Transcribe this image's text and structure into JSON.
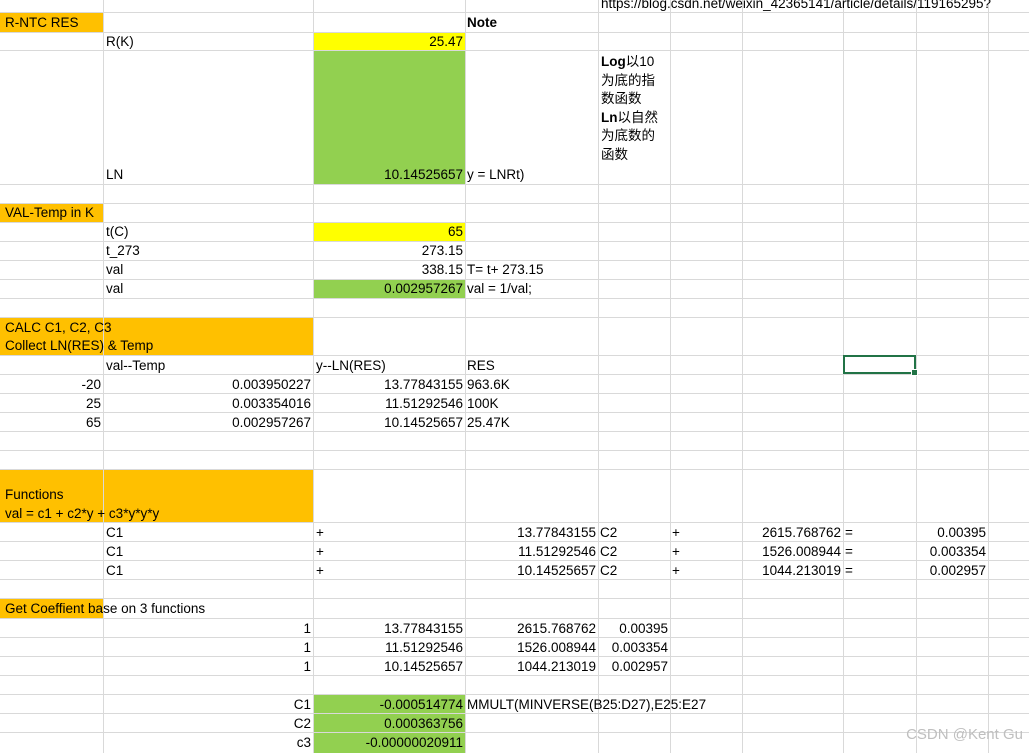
{
  "url": "https://blog.csdn.net/weixin_42365141/article/details/119165295?",
  "watermark": "CSDN @Kent Gu",
  "colors": {
    "orange": "#FFC000",
    "yellow": "#FFFF00",
    "green": "#92D050",
    "grid": "#D9D9D9",
    "select": "#217346"
  },
  "note": {
    "header": "Note",
    "lines": [
      {
        "bold": "Log",
        "text": "以10"
      },
      {
        "bold": "",
        "text": "为底的指"
      },
      {
        "bold": "",
        "text": "数函数"
      },
      {
        "bold": "Ln",
        "text": "以自然"
      },
      {
        "bold": "",
        "text": "为底数的"
      },
      {
        "bold": "",
        "text": "函数"
      }
    ]
  },
  "cells": [
    {
      "id": "a1",
      "text": "R-NTC RES",
      "align": "l"
    },
    {
      "id": "b2",
      "text": "R(K)",
      "align": "l"
    },
    {
      "id": "c2",
      "text": "25.47",
      "align": "r"
    },
    {
      "id": "b3",
      "text": "LN",
      "align": "l"
    },
    {
      "id": "c3",
      "text": "10.14525657",
      "align": "r"
    },
    {
      "id": "d3",
      "text": "y = LNRt)",
      "align": "l"
    },
    {
      "id": "a5",
      "text": "VAL-Temp in K",
      "align": "l"
    },
    {
      "id": "b6",
      "text": "t(C)",
      "align": "l"
    },
    {
      "id": "c6",
      "text": "65",
      "align": "r"
    },
    {
      "id": "b7",
      "text": "t_273",
      "align": "l"
    },
    {
      "id": "c7",
      "text": "273.15",
      "align": "r"
    },
    {
      "id": "b8",
      "text": "val",
      "align": "l"
    },
    {
      "id": "c8",
      "text": "338.15",
      "align": "r"
    },
    {
      "id": "d8",
      "text": "T= t+ 273.15",
      "align": "l"
    },
    {
      "id": "b9",
      "text": "val",
      "align": "l"
    },
    {
      "id": "c9",
      "text": "0.002957267",
      "align": "r"
    },
    {
      "id": "d9",
      "text": "val = 1/val;",
      "align": "l"
    },
    {
      "id": "a11a",
      "text": "CALC C1, C2, C3",
      "align": "l"
    },
    {
      "id": "a11b",
      "text": "Collect  LN(RES) & Temp",
      "align": "l"
    },
    {
      "id": "b12",
      "text": "val--Temp",
      "align": "l"
    },
    {
      "id": "c12",
      "text": "y--LN(RES)",
      "align": "l"
    },
    {
      "id": "d12",
      "text": "RES",
      "align": "l"
    },
    {
      "id": "a13",
      "text": "-20",
      "align": "r"
    },
    {
      "id": "b13",
      "text": "0.003950227",
      "align": "r"
    },
    {
      "id": "c13",
      "text": "13.77843155",
      "align": "r"
    },
    {
      "id": "d13",
      "text": "963.6K",
      "align": "l"
    },
    {
      "id": "a14",
      "text": "25",
      "align": "r"
    },
    {
      "id": "b14",
      "text": "0.003354016",
      "align": "r"
    },
    {
      "id": "c14",
      "text": "11.51292546",
      "align": "r"
    },
    {
      "id": "d14",
      "text": "100K",
      "align": "l"
    },
    {
      "id": "a15",
      "text": "65",
      "align": "r"
    },
    {
      "id": "b15",
      "text": "0.002957267",
      "align": "r"
    },
    {
      "id": "c15",
      "text": "10.14525657",
      "align": "r"
    },
    {
      "id": "d15",
      "text": "25.47K",
      "align": "l"
    },
    {
      "id": "a18a",
      "text": "Functions",
      "align": "l"
    },
    {
      "id": "a18b",
      "text": "val = c1 + c2*y + c3*y*y*y",
      "align": "l"
    },
    {
      "id": "b19",
      "text": "C1",
      "align": "l"
    },
    {
      "id": "c19",
      "text": "+",
      "align": "l"
    },
    {
      "id": "d19",
      "text": "13.77843155",
      "align": "r"
    },
    {
      "id": "e19",
      "text": "C2",
      "align": "l"
    },
    {
      "id": "f19",
      "text": "+",
      "align": "l"
    },
    {
      "id": "g19",
      "text": "2615.768762",
      "align": "r"
    },
    {
      "id": "h19",
      "text": "=",
      "align": "l"
    },
    {
      "id": "i19",
      "text": "0.00395",
      "align": "r"
    },
    {
      "id": "b20",
      "text": "C1",
      "align": "l"
    },
    {
      "id": "c20",
      "text": "+",
      "align": "l"
    },
    {
      "id": "d20",
      "text": "11.51292546",
      "align": "r"
    },
    {
      "id": "e20",
      "text": "C2",
      "align": "l"
    },
    {
      "id": "f20",
      "text": "+",
      "align": "l"
    },
    {
      "id": "g20",
      "text": "1526.008944",
      "align": "r"
    },
    {
      "id": "h20",
      "text": "=",
      "align": "l"
    },
    {
      "id": "i20",
      "text": "0.003354",
      "align": "r"
    },
    {
      "id": "b21",
      "text": "C1",
      "align": "l"
    },
    {
      "id": "c21",
      "text": "+",
      "align": "l"
    },
    {
      "id": "d21",
      "text": "10.14525657",
      "align": "r"
    },
    {
      "id": "e21",
      "text": "C2",
      "align": "l"
    },
    {
      "id": "f21",
      "text": "+",
      "align": "l"
    },
    {
      "id": "g21",
      "text": "1044.213019",
      "align": "r"
    },
    {
      "id": "h21",
      "text": "=",
      "align": "l"
    },
    {
      "id": "i21",
      "text": "0.002957",
      "align": "r"
    },
    {
      "id": "a23",
      "text": "Get Coeffient base on 3 functions",
      "align": "l"
    },
    {
      "id": "b24",
      "text": "1",
      "align": "r"
    },
    {
      "id": "c24",
      "text": "13.77843155",
      "align": "r"
    },
    {
      "id": "d24",
      "text": "2615.768762",
      "align": "r"
    },
    {
      "id": "e24",
      "text": "0.00395",
      "align": "r"
    },
    {
      "id": "b25",
      "text": "1",
      "align": "r"
    },
    {
      "id": "c25",
      "text": "11.51292546",
      "align": "r"
    },
    {
      "id": "d25",
      "text": "1526.008944",
      "align": "r"
    },
    {
      "id": "e25",
      "text": "0.003354",
      "align": "r"
    },
    {
      "id": "b26",
      "text": "1",
      "align": "r"
    },
    {
      "id": "c26",
      "text": "10.14525657",
      "align": "r"
    },
    {
      "id": "d26",
      "text": "1044.213019",
      "align": "r"
    },
    {
      "id": "e26",
      "text": "0.002957",
      "align": "r"
    },
    {
      "id": "b28",
      "text": "C1",
      "align": "r"
    },
    {
      "id": "c28",
      "text": "-0.000514774",
      "align": "r"
    },
    {
      "id": "d28",
      "text": "MMULT(MINVERSE(B25:D27),E25:E27",
      "align": "l"
    },
    {
      "id": "b29",
      "text": "C2",
      "align": "r"
    },
    {
      "id": "c29",
      "text": "0.000363756",
      "align": "r"
    },
    {
      "id": "b30",
      "text": "c3",
      "align": "r"
    },
    {
      "id": "c30",
      "text": "-0.00000020911",
      "align": "r"
    }
  ]
}
